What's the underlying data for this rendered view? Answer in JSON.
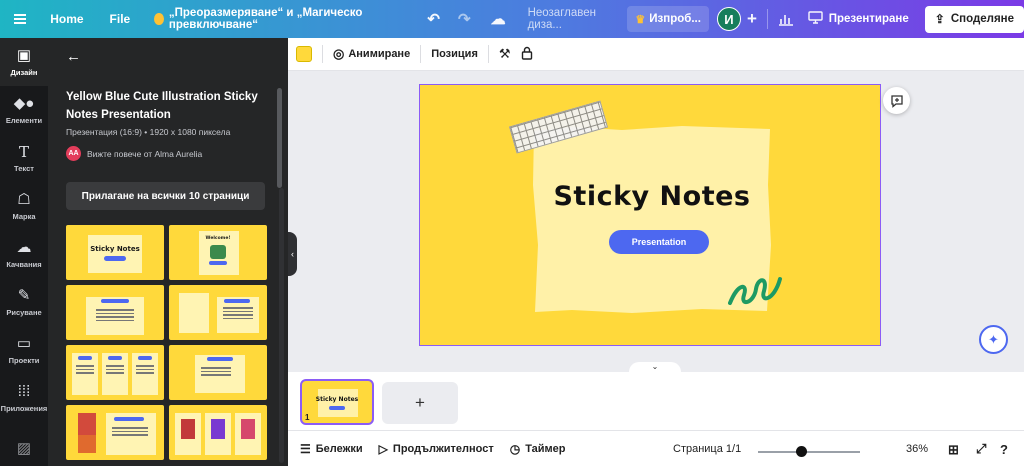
{
  "topbar": {
    "home": "Home",
    "file": "File",
    "title": "„Преоразмеряване“ и „Магическо превключване“",
    "design_name": "Неозаглавен диза...",
    "try": "Изпроб...",
    "avatar": "И",
    "present": "Презентиране",
    "share": "Споделяне"
  },
  "rail": {
    "items": [
      {
        "label": "Дизайн",
        "icon": "design-icon"
      },
      {
        "label": "Елементи",
        "icon": "elements-icon"
      },
      {
        "label": "Текст",
        "icon": "text-icon"
      },
      {
        "label": "Марка",
        "icon": "brand-icon"
      },
      {
        "label": "Качвания",
        "icon": "upload-icon"
      },
      {
        "label": "Рисуване",
        "icon": "draw-icon"
      },
      {
        "label": "Проекти",
        "icon": "folder-icon"
      },
      {
        "label": "Приложения",
        "icon": "apps-icon"
      }
    ]
  },
  "panel": {
    "title": "Yellow Blue Cute Illustration Sticky Notes Presentation",
    "meta": "Презентация (16:9) • 1920 x 1080 пиксела",
    "author_initials": "AA",
    "author": "Вижте повече от Alma Aurelia",
    "apply_all": "Прилагане на всички 10 страници"
  },
  "thumbnails": [
    {
      "title": "Sticky Notes"
    },
    {
      "title": "Welcome!"
    }
  ],
  "ctx": {
    "animate": "Анимиране",
    "position": "Позиция"
  },
  "slide": {
    "title": "Sticky Notes",
    "button": "Presentation"
  },
  "pages": {
    "thumb_title": "Sticky Notes",
    "page_number": "1",
    "add": "+"
  },
  "bottom": {
    "notes": "Бележки",
    "duration": "Продължителност",
    "timer": "Таймер",
    "page": "Страница 1/1",
    "zoom": "36%"
  },
  "colors": {
    "slide_bg": "#ffd93b",
    "paper": "#fff1a8",
    "accent_blue": "#4d68f0",
    "selection": "#8b5cf6",
    "squiggle": "#1d9a63"
  }
}
